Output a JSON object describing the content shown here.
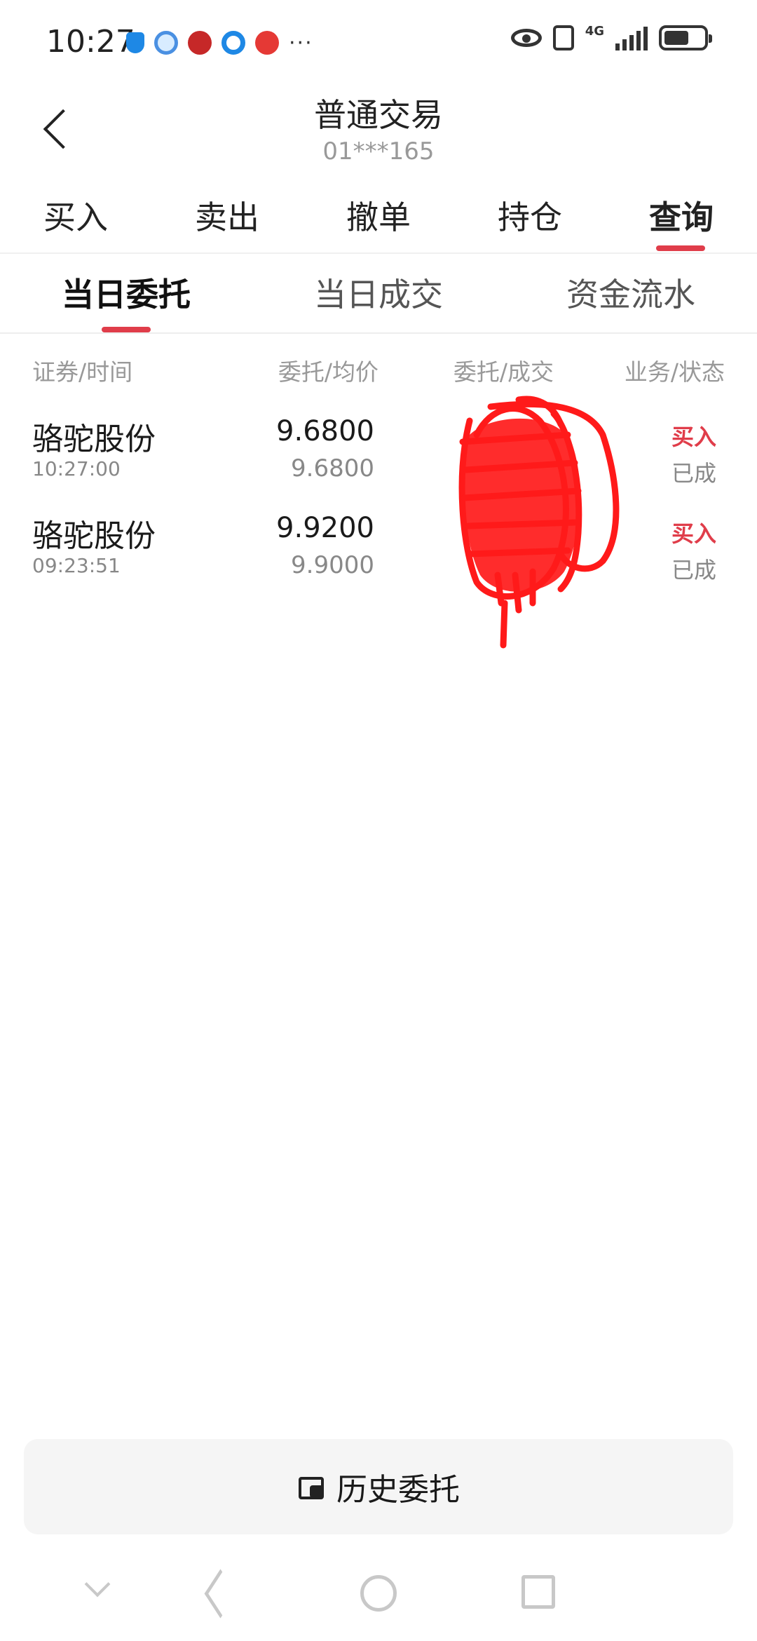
{
  "status_bar": {
    "time": "10:27",
    "network": "4G",
    "more": "···"
  },
  "header": {
    "title": "普通交易",
    "account": "01***165"
  },
  "main_tabs": [
    {
      "label": "买入",
      "active": false
    },
    {
      "label": "卖出",
      "active": false
    },
    {
      "label": "撤单",
      "active": false
    },
    {
      "label": "持仓",
      "active": false
    },
    {
      "label": "查询",
      "active": true
    }
  ],
  "sub_tabs": [
    {
      "label": "当日委托",
      "active": true
    },
    {
      "label": "当日成交",
      "active": false
    },
    {
      "label": "资金流水",
      "active": false
    }
  ],
  "table": {
    "headers": [
      "证券/时间",
      "委托/均价",
      "委托/成交",
      "业务/状态"
    ],
    "rows": [
      {
        "name": "骆驼股份",
        "time": "10:27:00",
        "price": "9.6800",
        "avg": "9.6800",
        "business": "买入",
        "status": "已成"
      },
      {
        "name": "骆驼股份",
        "time": "09:23:51",
        "price": "9.9200",
        "avg": "9.9000",
        "business": "买入",
        "status": "已成"
      }
    ]
  },
  "history_button": {
    "label": "历史委托",
    "icon": "history-orders-icon"
  },
  "colors": {
    "accent": "#e03d4a",
    "redaction": "#ff0000"
  }
}
